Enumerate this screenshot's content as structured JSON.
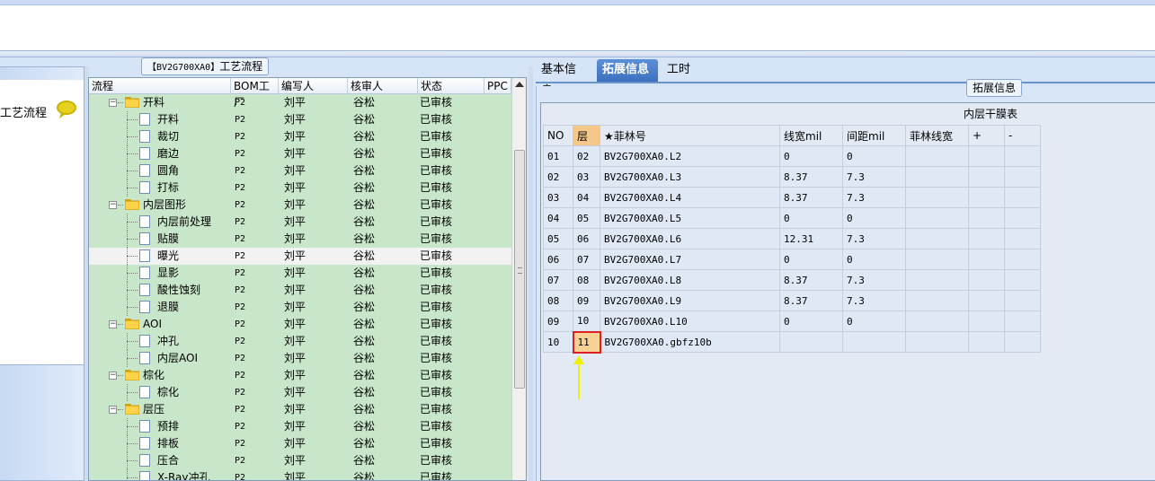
{
  "left": {
    "label": "工艺流程"
  },
  "middle": {
    "title_code": "【BV2G700XA0】",
    "title_text": "工艺流程",
    "columns": [
      "流程",
      "BOM工厂",
      "编写人",
      "核审人",
      "状态",
      "PPC"
    ],
    "rows": [
      {
        "name": "开料",
        "level": 0,
        "bom": "P2",
        "writer": "刘平",
        "reviewer": "谷松",
        "status": "已审核"
      },
      {
        "name": "开料",
        "level": 1,
        "bom": "P2",
        "writer": "刘平",
        "reviewer": "谷松",
        "status": "已审核"
      },
      {
        "name": "裁切",
        "level": 1,
        "bom": "P2",
        "writer": "刘平",
        "reviewer": "谷松",
        "status": "已审核"
      },
      {
        "name": "磨边",
        "level": 1,
        "bom": "P2",
        "writer": "刘平",
        "reviewer": "谷松",
        "status": "已审核"
      },
      {
        "name": "圆角",
        "level": 1,
        "bom": "P2",
        "writer": "刘平",
        "reviewer": "谷松",
        "status": "已审核"
      },
      {
        "name": "打标",
        "level": 1,
        "bom": "P2",
        "writer": "刘平",
        "reviewer": "谷松",
        "status": "已审核"
      },
      {
        "name": "内层图形",
        "level": 0,
        "bom": "P2",
        "writer": "刘平",
        "reviewer": "谷松",
        "status": "已审核"
      },
      {
        "name": "内层前处理",
        "level": 1,
        "bom": "P2",
        "writer": "刘平",
        "reviewer": "谷松",
        "status": "已审核"
      },
      {
        "name": "贴膜",
        "level": 1,
        "bom": "P2",
        "writer": "刘平",
        "reviewer": "谷松",
        "status": "已审核"
      },
      {
        "name": "曝光",
        "level": 1,
        "bom": "P2",
        "writer": "刘平",
        "reviewer": "谷松",
        "status": "已审核",
        "selected": true
      },
      {
        "name": "显影",
        "level": 1,
        "bom": "P2",
        "writer": "刘平",
        "reviewer": "谷松",
        "status": "已审核"
      },
      {
        "name": "酸性蚀刻",
        "level": 1,
        "bom": "P2",
        "writer": "刘平",
        "reviewer": "谷松",
        "status": "已审核"
      },
      {
        "name": "退膜",
        "level": 1,
        "bom": "P2",
        "writer": "刘平",
        "reviewer": "谷松",
        "status": "已审核"
      },
      {
        "name": "AOI",
        "level": 0,
        "bom": "P2",
        "writer": "刘平",
        "reviewer": "谷松",
        "status": "已审核"
      },
      {
        "name": "冲孔",
        "level": 1,
        "bom": "P2",
        "writer": "刘平",
        "reviewer": "谷松",
        "status": "已审核"
      },
      {
        "name": "内层AOI",
        "level": 1,
        "bom": "P2",
        "writer": "刘平",
        "reviewer": "谷松",
        "status": "已审核"
      },
      {
        "name": "棕化",
        "level": 0,
        "bom": "P2",
        "writer": "刘平",
        "reviewer": "谷松",
        "status": "已审核"
      },
      {
        "name": "棕化",
        "level": 1,
        "bom": "P2",
        "writer": "刘平",
        "reviewer": "谷松",
        "status": "已审核"
      },
      {
        "name": "层压",
        "level": 0,
        "bom": "P2",
        "writer": "刘平",
        "reviewer": "谷松",
        "status": "已审核"
      },
      {
        "name": "预排",
        "level": 1,
        "bom": "P2",
        "writer": "刘平",
        "reviewer": "谷松",
        "status": "已审核"
      },
      {
        "name": "排板",
        "level": 1,
        "bom": "P2",
        "writer": "刘平",
        "reviewer": "谷松",
        "status": "已审核"
      },
      {
        "name": "压合",
        "level": 1,
        "bom": "P2",
        "writer": "刘平",
        "reviewer": "谷松",
        "status": "已审核"
      },
      {
        "name": "X-Ray冲孔",
        "level": 1,
        "bom": "P2",
        "writer": "刘平",
        "reviewer": "谷松",
        "status": "已审核"
      }
    ]
  },
  "right": {
    "tabs": [
      "基本信息",
      "拓展信息",
      "工时"
    ],
    "active_tab": 1,
    "group_title": "拓展信息",
    "grid_caption": "内层干膜表",
    "columns": [
      "NO",
      "层",
      "★菲林号",
      "线宽mil",
      "间距mil",
      "菲林线宽",
      "+",
      "-"
    ],
    "rows": [
      [
        "01",
        "02",
        "BV2G700XA0.L2",
        "0",
        "0"
      ],
      [
        "02",
        "03",
        "BV2G700XA0.L3",
        "8.37",
        "7.3"
      ],
      [
        "03",
        "04",
        "BV2G700XA0.L4",
        "8.37",
        "7.3"
      ],
      [
        "04",
        "05",
        "BV2G700XA0.L5",
        "0",
        "0"
      ],
      [
        "05",
        "06",
        "BV2G700XA0.L6",
        "12.31",
        "7.3"
      ],
      [
        "06",
        "07",
        "BV2G700XA0.L7",
        "0",
        "0"
      ],
      [
        "07",
        "08",
        "BV2G700XA0.L8",
        "8.37",
        "7.3"
      ],
      [
        "08",
        "09",
        "BV2G700XA0.L9",
        "8.37",
        "7.3"
      ],
      [
        "09",
        "10",
        "BV2G700XA0.L10",
        "0",
        "0"
      ],
      [
        "10",
        "11",
        "BV2G700XA0.gbfz10b",
        "",
        ""
      ]
    ],
    "highlight_row": 9
  },
  "colors": {
    "tree_bg": "#c8e6c9",
    "tab_active": "#3b6fbf",
    "highlight_border": "#e02020",
    "arrow": "#f0f000"
  },
  "icons": [
    "chat-bubble-icon",
    "folder-icon",
    "document-icon",
    "expander-minus-icon",
    "scroll-up-icon"
  ]
}
